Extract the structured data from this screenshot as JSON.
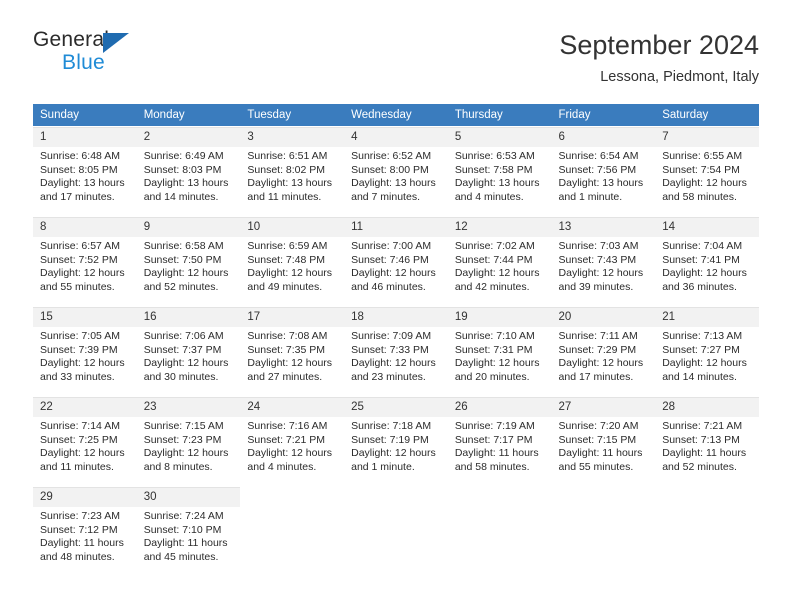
{
  "brand": {
    "name_part1": "General",
    "name_part2": "Blue",
    "triangle_color": "#1f6bb0",
    "blue_color": "#1f8bd6"
  },
  "header": {
    "month_title": "September 2024",
    "location": "Lessona, Piedmont, Italy"
  },
  "theme": {
    "header_row_bg": "#3a7cbe",
    "daynum_bg": "#f2f2f2",
    "text_color": "#2b2b2b"
  },
  "weekday_headers": [
    "Sunday",
    "Monday",
    "Tuesday",
    "Wednesday",
    "Thursday",
    "Friday",
    "Saturday"
  ],
  "weeks": [
    [
      {
        "day": "1",
        "sunrise": "Sunrise: 6:48 AM",
        "sunset": "Sunset: 8:05 PM",
        "daylight_line1": "Daylight: 13 hours",
        "daylight_line2": "and 17 minutes."
      },
      {
        "day": "2",
        "sunrise": "Sunrise: 6:49 AM",
        "sunset": "Sunset: 8:03 PM",
        "daylight_line1": "Daylight: 13 hours",
        "daylight_line2": "and 14 minutes."
      },
      {
        "day": "3",
        "sunrise": "Sunrise: 6:51 AM",
        "sunset": "Sunset: 8:02 PM",
        "daylight_line1": "Daylight: 13 hours",
        "daylight_line2": "and 11 minutes."
      },
      {
        "day": "4",
        "sunrise": "Sunrise: 6:52 AM",
        "sunset": "Sunset: 8:00 PM",
        "daylight_line1": "Daylight: 13 hours",
        "daylight_line2": "and 7 minutes."
      },
      {
        "day": "5",
        "sunrise": "Sunrise: 6:53 AM",
        "sunset": "Sunset: 7:58 PM",
        "daylight_line1": "Daylight: 13 hours",
        "daylight_line2": "and 4 minutes."
      },
      {
        "day": "6",
        "sunrise": "Sunrise: 6:54 AM",
        "sunset": "Sunset: 7:56 PM",
        "daylight_line1": "Daylight: 13 hours",
        "daylight_line2": "and 1 minute."
      },
      {
        "day": "7",
        "sunrise": "Sunrise: 6:55 AM",
        "sunset": "Sunset: 7:54 PM",
        "daylight_line1": "Daylight: 12 hours",
        "daylight_line2": "and 58 minutes."
      }
    ],
    [
      {
        "day": "8",
        "sunrise": "Sunrise: 6:57 AM",
        "sunset": "Sunset: 7:52 PM",
        "daylight_line1": "Daylight: 12 hours",
        "daylight_line2": "and 55 minutes."
      },
      {
        "day": "9",
        "sunrise": "Sunrise: 6:58 AM",
        "sunset": "Sunset: 7:50 PM",
        "daylight_line1": "Daylight: 12 hours",
        "daylight_line2": "and 52 minutes."
      },
      {
        "day": "10",
        "sunrise": "Sunrise: 6:59 AM",
        "sunset": "Sunset: 7:48 PM",
        "daylight_line1": "Daylight: 12 hours",
        "daylight_line2": "and 49 minutes."
      },
      {
        "day": "11",
        "sunrise": "Sunrise: 7:00 AM",
        "sunset": "Sunset: 7:46 PM",
        "daylight_line1": "Daylight: 12 hours",
        "daylight_line2": "and 46 minutes."
      },
      {
        "day": "12",
        "sunrise": "Sunrise: 7:02 AM",
        "sunset": "Sunset: 7:44 PM",
        "daylight_line1": "Daylight: 12 hours",
        "daylight_line2": "and 42 minutes."
      },
      {
        "day": "13",
        "sunrise": "Sunrise: 7:03 AM",
        "sunset": "Sunset: 7:43 PM",
        "daylight_line1": "Daylight: 12 hours",
        "daylight_line2": "and 39 minutes."
      },
      {
        "day": "14",
        "sunrise": "Sunrise: 7:04 AM",
        "sunset": "Sunset: 7:41 PM",
        "daylight_line1": "Daylight: 12 hours",
        "daylight_line2": "and 36 minutes."
      }
    ],
    [
      {
        "day": "15",
        "sunrise": "Sunrise: 7:05 AM",
        "sunset": "Sunset: 7:39 PM",
        "daylight_line1": "Daylight: 12 hours",
        "daylight_line2": "and 33 minutes."
      },
      {
        "day": "16",
        "sunrise": "Sunrise: 7:06 AM",
        "sunset": "Sunset: 7:37 PM",
        "daylight_line1": "Daylight: 12 hours",
        "daylight_line2": "and 30 minutes."
      },
      {
        "day": "17",
        "sunrise": "Sunrise: 7:08 AM",
        "sunset": "Sunset: 7:35 PM",
        "daylight_line1": "Daylight: 12 hours",
        "daylight_line2": "and 27 minutes."
      },
      {
        "day": "18",
        "sunrise": "Sunrise: 7:09 AM",
        "sunset": "Sunset: 7:33 PM",
        "daylight_line1": "Daylight: 12 hours",
        "daylight_line2": "and 23 minutes."
      },
      {
        "day": "19",
        "sunrise": "Sunrise: 7:10 AM",
        "sunset": "Sunset: 7:31 PM",
        "daylight_line1": "Daylight: 12 hours",
        "daylight_line2": "and 20 minutes."
      },
      {
        "day": "20",
        "sunrise": "Sunrise: 7:11 AM",
        "sunset": "Sunset: 7:29 PM",
        "daylight_line1": "Daylight: 12 hours",
        "daylight_line2": "and 17 minutes."
      },
      {
        "day": "21",
        "sunrise": "Sunrise: 7:13 AM",
        "sunset": "Sunset: 7:27 PM",
        "daylight_line1": "Daylight: 12 hours",
        "daylight_line2": "and 14 minutes."
      }
    ],
    [
      {
        "day": "22",
        "sunrise": "Sunrise: 7:14 AM",
        "sunset": "Sunset: 7:25 PM",
        "daylight_line1": "Daylight: 12 hours",
        "daylight_line2": "and 11 minutes."
      },
      {
        "day": "23",
        "sunrise": "Sunrise: 7:15 AM",
        "sunset": "Sunset: 7:23 PM",
        "daylight_line1": "Daylight: 12 hours",
        "daylight_line2": "and 8 minutes."
      },
      {
        "day": "24",
        "sunrise": "Sunrise: 7:16 AM",
        "sunset": "Sunset: 7:21 PM",
        "daylight_line1": "Daylight: 12 hours",
        "daylight_line2": "and 4 minutes."
      },
      {
        "day": "25",
        "sunrise": "Sunrise: 7:18 AM",
        "sunset": "Sunset: 7:19 PM",
        "daylight_line1": "Daylight: 12 hours",
        "daylight_line2": "and 1 minute."
      },
      {
        "day": "26",
        "sunrise": "Sunrise: 7:19 AM",
        "sunset": "Sunset: 7:17 PM",
        "daylight_line1": "Daylight: 11 hours",
        "daylight_line2": "and 58 minutes."
      },
      {
        "day": "27",
        "sunrise": "Sunrise: 7:20 AM",
        "sunset": "Sunset: 7:15 PM",
        "daylight_line1": "Daylight: 11 hours",
        "daylight_line2": "and 55 minutes."
      },
      {
        "day": "28",
        "sunrise": "Sunrise: 7:21 AM",
        "sunset": "Sunset: 7:13 PM",
        "daylight_line1": "Daylight: 11 hours",
        "daylight_line2": "and 52 minutes."
      }
    ],
    [
      {
        "day": "29",
        "sunrise": "Sunrise: 7:23 AM",
        "sunset": "Sunset: 7:12 PM",
        "daylight_line1": "Daylight: 11 hours",
        "daylight_line2": "and 48 minutes."
      },
      {
        "day": "30",
        "sunrise": "Sunrise: 7:24 AM",
        "sunset": "Sunset: 7:10 PM",
        "daylight_line1": "Daylight: 11 hours",
        "daylight_line2": "and 45 minutes."
      },
      null,
      null,
      null,
      null,
      null
    ]
  ]
}
